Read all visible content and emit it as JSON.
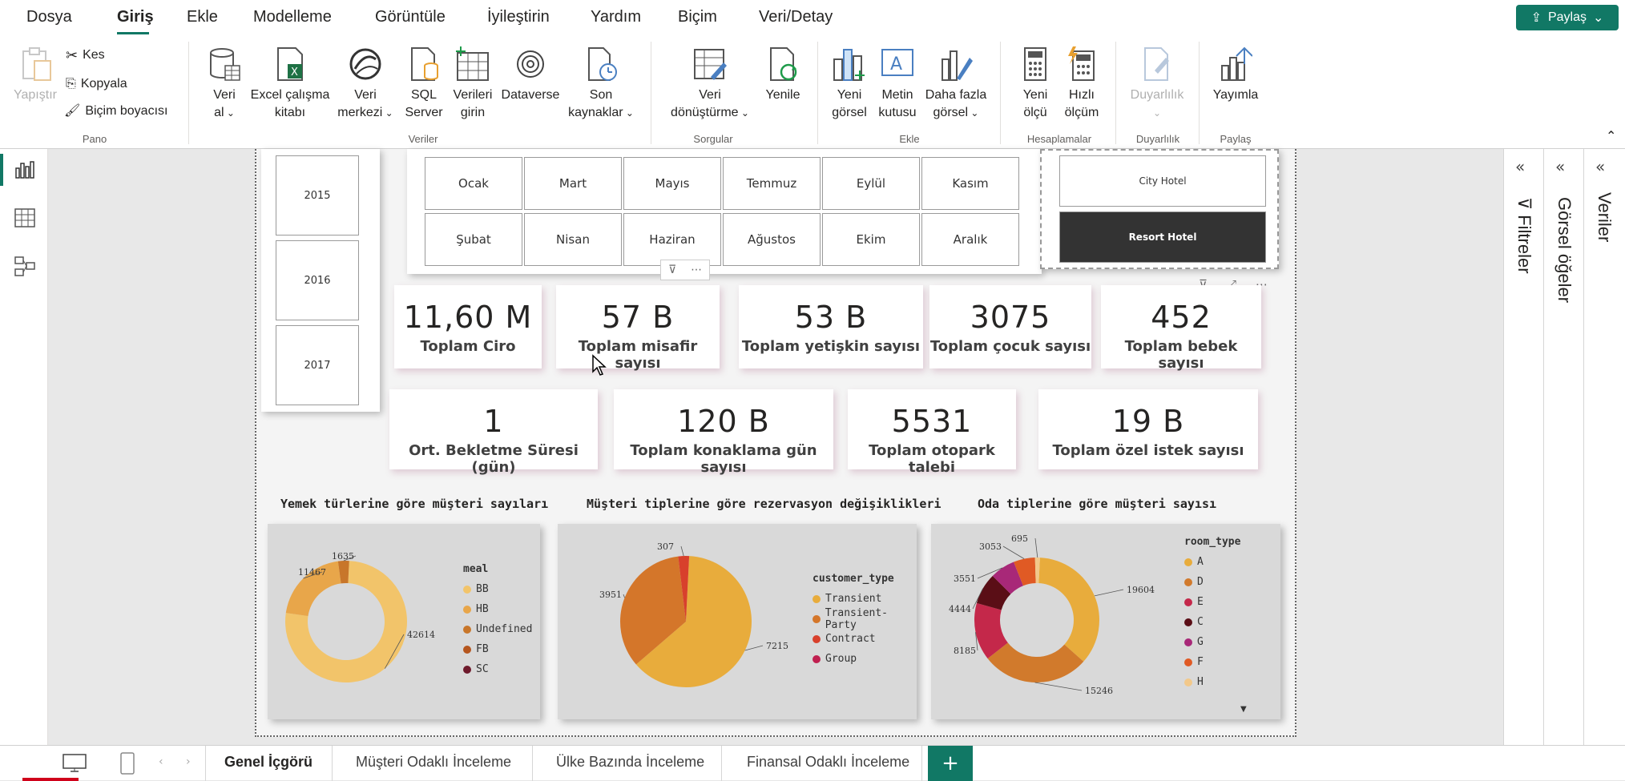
{
  "menubar": {
    "tabs": [
      "Dosya",
      "Giriş",
      "Ekle",
      "Modelleme",
      "Görüntüle",
      "İyileştirin",
      "Yardım",
      "Biçim",
      "Veri/Detay"
    ],
    "share_label": "Paylaş"
  },
  "ribbon": {
    "pano": {
      "paste": "Yapıştır",
      "cut": "Kes",
      "copy": "Kopyala",
      "format_painter": "Biçim boyacısı",
      "group": "Pano"
    },
    "veriler": {
      "get_data_1": "Veri",
      "get_data_2": "al",
      "excel_1": "Excel çalışma",
      "excel_2": "kitabı",
      "hub_1": "Veri",
      "hub_2": "merkezi",
      "sql_1": "SQL",
      "sql_2": "Server",
      "enter_1": "Verileri",
      "enter_2": "girin",
      "dataverse": "Dataverse",
      "recent_1": "Son",
      "recent_2": "kaynaklar",
      "group": "Veriler"
    },
    "sorgular": {
      "transform_1": "Veri",
      "transform_2": "dönüştürme",
      "refresh": "Yenile",
      "group": "Sorgular"
    },
    "ekle": {
      "new_visual_1": "Yeni",
      "new_visual_2": "görsel",
      "textbox_1": "Metin",
      "textbox_2": "kutusu",
      "more_1": "Daha fazla",
      "more_2": "görsel",
      "group": "Ekle"
    },
    "hesaplamalar": {
      "new_measure_1": "Yeni",
      "new_measure_2": "ölçü",
      "quick_1": "Hızlı",
      "quick_2": "ölçüm",
      "group": "Hesaplamalar"
    },
    "duyarlilik": {
      "label": "Duyarlılık",
      "group": "Duyarlılık"
    },
    "paylas": {
      "publish": "Yayımla",
      "group": "Paylaş"
    }
  },
  "panes": {
    "filters": "Filtreler",
    "visuals": "Görsel öğeler",
    "data": "Veriler"
  },
  "report": {
    "years": [
      "2015",
      "2016",
      "2017"
    ],
    "months": [
      "Ocak",
      "Mart",
      "Mayıs",
      "Temmuz",
      "Eylül",
      "Kasım",
      "Şubat",
      "Nisan",
      "Haziran",
      "Ağustos",
      "Ekim",
      "Aralık"
    ],
    "hotels": [
      "City Hotel",
      "Resort Hotel"
    ],
    "selected_hotel": "Resort Hotel",
    "cards_row1": [
      {
        "value": "11,60 M",
        "label": "Toplam Ciro"
      },
      {
        "value": "57 B",
        "label": "Toplam misafir sayısı"
      },
      {
        "value": "53 B",
        "label": "Toplam yetişkin sayısı"
      },
      {
        "value": "3075",
        "label": "Toplam çocuk sayısı"
      },
      {
        "value": "452",
        "label": "Toplam bebek sayısı"
      }
    ],
    "cards_row2": [
      {
        "value": "1",
        "label": "Ort. Bekletme Süresi (gün)"
      },
      {
        "value": "120 B",
        "label": "Toplam konaklama gün sayısı"
      },
      {
        "value": "5531",
        "label": "Toplam otopark talebi"
      },
      {
        "value": "19 B",
        "label": "Toplam özel istek sayısı"
      }
    ]
  },
  "chart_data": [
    {
      "type": "pie",
      "variant": "donut",
      "title": "Yemek türlerine göre müşteri sayıları",
      "legend_title": "meal",
      "categories": [
        "BB",
        "HB",
        "Undefined",
        "FB",
        "SC"
      ],
      "values": [
        42614,
        11467,
        1635,
        0,
        0
      ],
      "data_labels": [
        "42614",
        "11467",
        "1635"
      ],
      "colors": [
        "#f2c46a",
        "#e8a64a",
        "#c8762a",
        "#b5561e",
        "#6e1a2c"
      ]
    },
    {
      "type": "pie",
      "title": "Müşteri tiplerine göre rezervasyon değişiklikleri",
      "legend_title": "customer_type",
      "categories": [
        "Transient",
        "Transient-Party",
        "Contract",
        "Group"
      ],
      "values": [
        7215,
        3951,
        307,
        0
      ],
      "data_labels": [
        "7215",
        "3951",
        "307"
      ],
      "colors": [
        "#e8ac3c",
        "#d4762a",
        "#d8402c",
        "#c02050"
      ]
    },
    {
      "type": "pie",
      "variant": "donut",
      "title": "Oda tiplerine göre müşteri sayısı",
      "legend_title": "room_type",
      "categories": [
        "A",
        "D",
        "E",
        "C",
        "G",
        "F",
        "H"
      ],
      "values": [
        19604,
        15246,
        8185,
        4444,
        3551,
        3053,
        695
      ],
      "data_labels": [
        "19604",
        "15246",
        "8185",
        "4444",
        "3551",
        "3053",
        "695"
      ],
      "colors": [
        "#e8ac3c",
        "#d17a2c",
        "#c4284a",
        "#5a0e16",
        "#a82878",
        "#e05a24",
        "#f2c88a"
      ]
    }
  ],
  "page_tabs": [
    "Genel İçgörü",
    "Müşteri Odaklı İnceleme",
    "Ülke Bazında İnceleme",
    "Finansal Odaklı İnceleme"
  ],
  "active_page": "Genel İçgörü",
  "add_page": "+"
}
